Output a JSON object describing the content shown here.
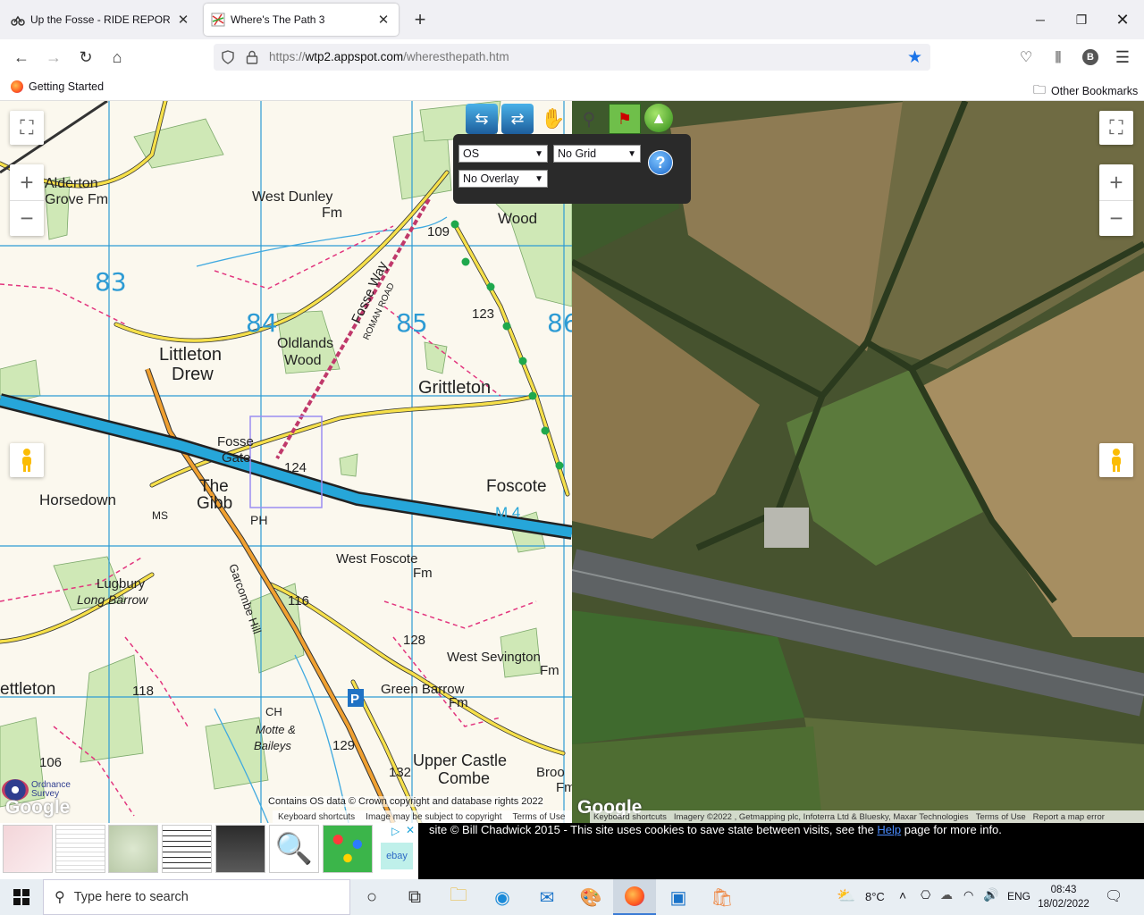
{
  "browser": {
    "tabs": [
      {
        "title": "Up the Fosse - RIDE REPORTS - |",
        "active": false
      },
      {
        "title": "Where's The Path 3",
        "active": true
      }
    ],
    "new_tab_label": "+",
    "url_scheme": "https://",
    "url_host": "wtp2.appspot.com",
    "url_path": "/wheresthepath.htm",
    "bookmarks": {
      "getting_started": "Getting Started",
      "other": "Other Bookmarks"
    },
    "profile_initial": "B"
  },
  "map_controls": {
    "layer_select": "OS",
    "grid_select": "No Grid",
    "overlay_select": "No Overlay",
    "help_label": "?"
  },
  "os_map": {
    "place_labels": [
      "Alderton",
      "Grove Fm",
      "West Dunley",
      "Fm",
      "Littleton",
      "Drew",
      "Oldlands",
      "Wood",
      "Grittleton",
      "Fosse",
      "Gate",
      "The",
      "Gibb",
      "Horsedown",
      "PH",
      "MS",
      "Foscote",
      "West Foscote",
      "Fm",
      "Lugbury",
      "Long Barrow",
      "West Sevington",
      "Fm",
      "Green Barrow",
      "Fm",
      "Upper Castle",
      "Combe",
      "Motte &",
      "Baileys",
      "Castle Combe",
      "ettleton",
      "Wood",
      "Fosse Way",
      "ROMAN ROAD",
      "M 4",
      "Garcombe Hill",
      "CH",
      "Broo",
      "Fm",
      "P"
    ],
    "grid_numbers": [
      "83",
      "84",
      "85",
      "86"
    ],
    "heights": [
      "109",
      "123",
      "124",
      "116",
      "128",
      "118",
      "129",
      "132",
      "106"
    ],
    "copyright": "Contains OS data © Crown copyright and database rights 2022",
    "os_logo": "Ordnance Survey",
    "google_logo": "Google",
    "attribution": [
      "Keyboard shortcuts",
      "Image may be subject to copyright",
      "Terms of Use"
    ]
  },
  "sat_map": {
    "google_logo": "Google",
    "attribution": [
      "Keyboard shortcuts",
      "Imagery ©2022 , Getmapping plc, Infoterra Ltd & Bluesky, Maxar Technologies",
      "Terms of Use",
      "Report a map error"
    ]
  },
  "footer": {
    "text_before": "site © Bill Chadwick 2015 - This site uses cookies to save state between visits, see the ",
    "link": "Help",
    "text_after": " page for more info.",
    "ad_label": "ebay"
  },
  "taskbar": {
    "search_placeholder": "Type here to search",
    "temperature": "8°C",
    "language": "ENG",
    "time": "08:43",
    "date": "18/02/2022"
  },
  "colors": {
    "os_grid": "#2d9bd4",
    "road_yellow": "#f6e04a",
    "road_orange": "#f0a030",
    "motorway": "#26a6d9",
    "woodland": "#cfe8b6",
    "footer_bg": "#000000",
    "link_blue": "#4a8cff"
  }
}
